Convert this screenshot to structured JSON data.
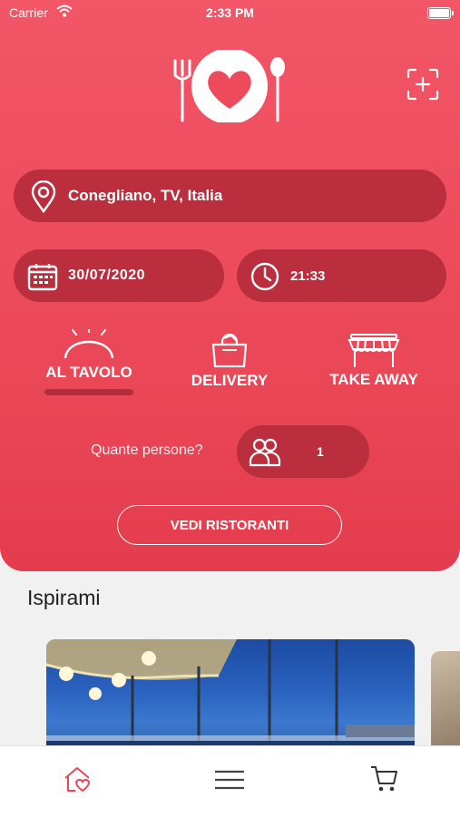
{
  "status_bar": {
    "carrier": "Carrier",
    "time": "2:33 PM"
  },
  "location": {
    "value": "Conegliano, TV, Italia",
    "icon": "map-pin-icon"
  },
  "date": {
    "value": "30/07/2020",
    "icon": "calendar-icon"
  },
  "time": {
    "value": "21:33",
    "icon": "clock-icon"
  },
  "modes": [
    {
      "label": "AL TAVOLO",
      "icon": "table-dome-icon",
      "selected": true
    },
    {
      "label": "DELIVERY",
      "icon": "bag-icon",
      "selected": false
    },
    {
      "label": "TAKE AWAY",
      "icon": "awning-icon",
      "selected": false
    }
  ],
  "persons": {
    "question": "Quante persone?",
    "count": "1",
    "icon": "people-icon"
  },
  "cta": {
    "label": "VEDI RISTORANTI"
  },
  "inspire": {
    "title": "Ispirami"
  },
  "tabbar": {
    "items": [
      "home-heart-icon",
      "menu-icon",
      "cart-icon"
    ]
  },
  "colors": {
    "brand": "#f25667",
    "pill": "#bb2e3d",
    "accent": "#e94656"
  }
}
